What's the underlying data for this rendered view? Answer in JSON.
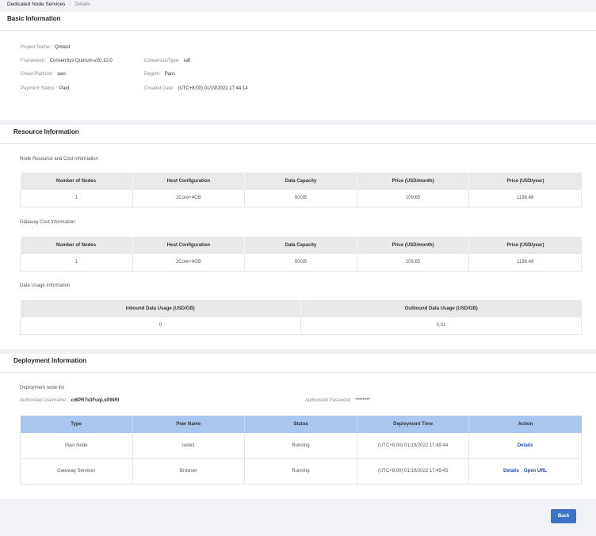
{
  "breadcrumb": {
    "root": "Dedicated Node Services",
    "separator": "/",
    "current": "Details"
  },
  "basic": {
    "title": "Basic Information",
    "project_name": {
      "label": "Project Name:",
      "value": "Qmtest"
    },
    "framework": {
      "label": "Framework:",
      "value": "ConsenSys Quorum-v20.10.0"
    },
    "consensus": {
      "label": "ConsensusType:",
      "value": "raft"
    },
    "cloud": {
      "label": "Cloud Platform:",
      "value": "aws"
    },
    "region": {
      "label": "Region:",
      "value": "Paris"
    },
    "payment": {
      "label": "Payment Status:",
      "value": "Paid"
    },
    "created": {
      "label": "Created Date:",
      "value": "(UTC+8:00) 01/19/2022 17:44:14"
    }
  },
  "resource": {
    "title": "Resource Information",
    "node_label": "Node Resource and Cost Information",
    "gateway_label": "Gateway Cost Information:",
    "usage_label": "Data Usage Information",
    "cost_headers": [
      "Number of Nodes",
      "Host Configuration",
      "Data Capacity",
      "Price (USD/month)",
      "Price (USD/year)"
    ],
    "node_row": [
      "1",
      "2Core+4GB",
      "50GB",
      "109.65",
      "1196.48"
    ],
    "gateway_row": [
      "1",
      "2Core+4GB",
      "50GB",
      "109.65",
      "1196.48"
    ],
    "usage_headers": [
      "Inbound Data Usage (USD/GB)",
      "Outbound Data Usage (USD/GB)"
    ],
    "usage_row": [
      "0",
      "0.01"
    ]
  },
  "deployment": {
    "title": "Deployment Information",
    "list_label": "Deployment node list",
    "username_label": "Authorized Username:",
    "username_value": "ci6PR7x3FuqLxPINRI",
    "password_label": "Authorized Password:",
    "password_value": "********",
    "headers": [
      "Type",
      "Peer Name",
      "Status",
      "Deployment Time",
      "Action"
    ],
    "rows": [
      {
        "type": "Peer Node",
        "peer": "node1",
        "status": "Running",
        "time": "(UTC+8:00) 01/19/2022 17:49:44",
        "actions": [
          "Details"
        ]
      },
      {
        "type": "Gateway Services",
        "peer": "Browser",
        "status": "Running",
        "time": "(UTC+8:00) 01/19/2022 17:49:45",
        "actions": [
          "Details",
          "Open URL"
        ]
      }
    ]
  },
  "back_label": "Back"
}
